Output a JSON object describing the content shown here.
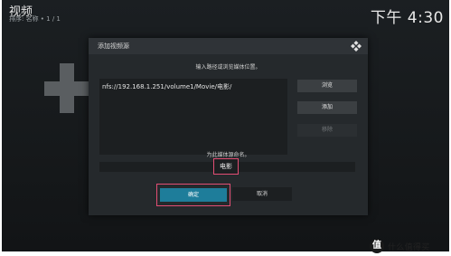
{
  "header": {
    "title": "视频",
    "subtitle": "排序: 名称 • 1 / 1",
    "clock": "下午 4:30"
  },
  "dialog": {
    "title": "添加视频源",
    "path_prompt": "输入路径或浏览媒体位置。",
    "path_value": "nfs://192.168.1.251/volume1/Movie/电影/",
    "browse_label": "浏览",
    "add_label": "添加",
    "remove_label": "移除",
    "name_prompt": "为此媒体源命名。",
    "name_value": "电影",
    "ok_label": "确定",
    "cancel_label": "取消"
  },
  "watermark": {
    "text": "什么值得买",
    "icon": "值"
  },
  "colors": {
    "accent": "#1e7d9a",
    "highlight": "#e24e74"
  }
}
